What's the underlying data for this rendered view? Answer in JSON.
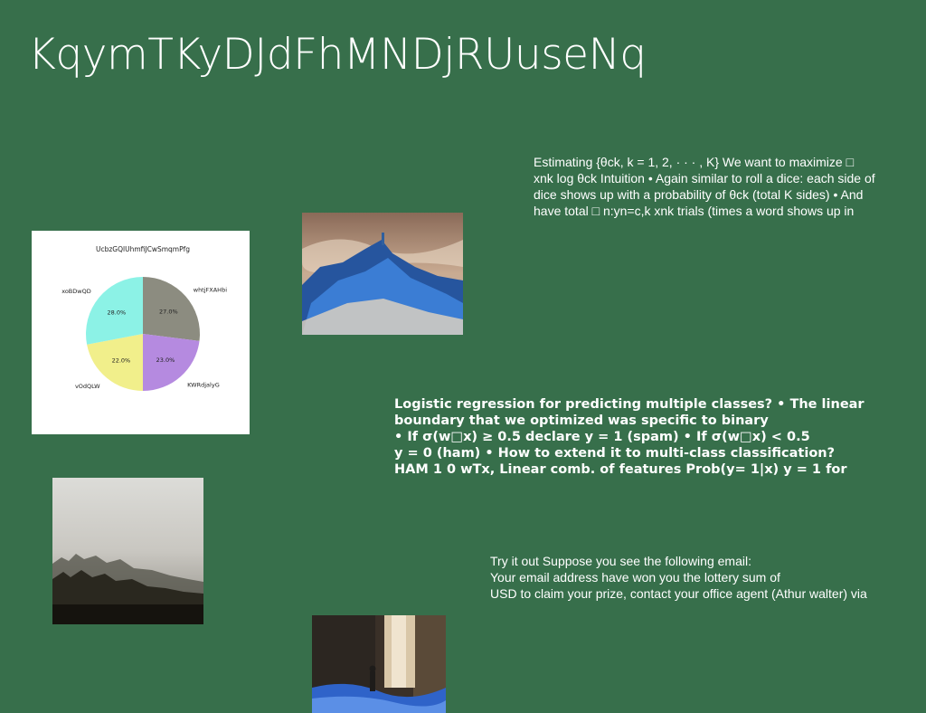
{
  "slide": {
    "title": "KqymTKyDJdFhMNDjRUuseNq",
    "paragraphs": {
      "estimating": "Estimating {θck, k = 1, 2, · · · , K} We want to maximize □\nxnk log θck Intuition • Again similar to roll a dice: each side of\ndice shows up with a probability of θck (total K sides) • And\nhave total □ n:yn=c,k xnk trials (times a word shows up in",
      "logistic": "Logistic regression for predicting multiple classes? • The linear\nboundary that we optimized was specific to binary\n• If σ(w□x) ≥ 0.5 declare y = 1 (spam) • If σ(w□x) < 0.5\ny = 0 (ham) • How to extend it to multi-class classification?\nHAM 1 0 wTx, Linear comb. of features Prob(y= 1|x) y = 1 for",
      "email": "Try it out Suppose you see the following email:\nYour email address have won you the lottery sum of\nUSD to claim your prize, contact your office agent (Athur walter) via"
    },
    "images": {
      "mountain": "image-mountain-blue",
      "forest": "image-foggy-forest",
      "waterfall": "image-waterfall"
    }
  },
  "chart_data": {
    "type": "pie",
    "title": "UcbzGQlUhmfiJCwSmqmPfg",
    "slices": [
      {
        "label": "whtjFXAHbi",
        "value": 27.0,
        "pct_label": "27.0%",
        "color": "#8c8c80"
      },
      {
        "label": "KWRdjalyG",
        "value": 23.0,
        "pct_label": "23.0%",
        "color": "#b58ae0"
      },
      {
        "label": "vOdQLW",
        "value": 22.0,
        "pct_label": "22.0%",
        "color": "#f1ef8b"
      },
      {
        "label": "xoBDwQD",
        "value": 28.0,
        "pct_label": "28.0%",
        "color": "#8cf2e6"
      }
    ],
    "start_angle_deg": 90,
    "direction": "clockwise"
  }
}
